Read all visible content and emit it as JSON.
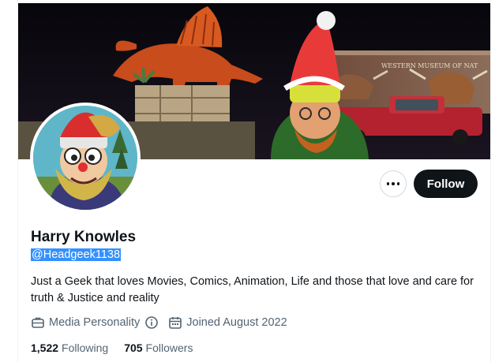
{
  "profile": {
    "display_name": "Harry Knowles",
    "handle": "@Headgeek1138",
    "bio": "Just a Geek that loves Movies, Comics, Animation, Life and those that love and care for truth & Justice and reality",
    "category": "Media Personality",
    "joined": "Joined August 2022",
    "following_count": "1,522",
    "following_label": "Following",
    "followers_count": "705",
    "followers_label": "Followers",
    "banner_sign_text": "WESTERN MUSEUM OF NAT"
  },
  "actions": {
    "follow_label": "Follow",
    "more_icon": "more-dots-icon"
  },
  "icons": {
    "category": "briefcase-icon",
    "info": "info-circle-icon",
    "calendar": "calendar-icon"
  },
  "colors": {
    "text_primary": "#0f1419",
    "text_secondary": "#536471",
    "follow_bg": "#0f1419",
    "selection": "#3390ff"
  }
}
